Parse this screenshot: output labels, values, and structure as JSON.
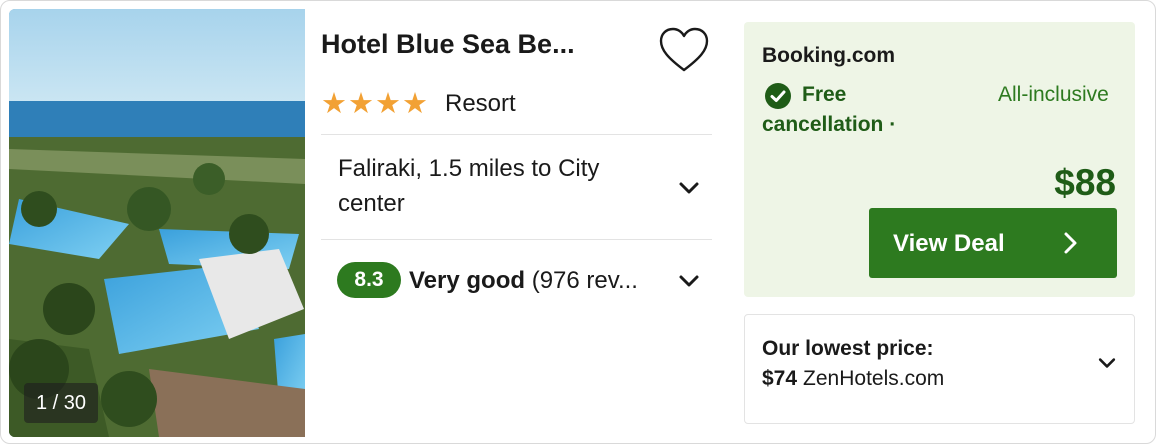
{
  "hotel": {
    "name": "Hotel Blue Sea Be...",
    "stars": 4,
    "type": "Resort",
    "location": "Faliraki, 1.5 miles to City center",
    "rating": {
      "score": "8.3",
      "label": "Very good",
      "reviews": "(976 rev..."
    }
  },
  "photo": {
    "counter": "1 / 30"
  },
  "deal": {
    "provider": "Booking.com",
    "cancellation": "Free cancellation",
    "separator": "·",
    "meal": "All-inclusive",
    "price": "$88",
    "button_label": "View Deal"
  },
  "lowest": {
    "label": "Our lowest price:",
    "price": "$74",
    "provider": "ZenHotels.com"
  },
  "icons": {
    "favorite": "heart-outline-icon",
    "expand": "chevron-down-icon",
    "check": "check-circle-icon",
    "next": "chevron-right-icon"
  },
  "colors": {
    "accent_green": "#2d7a1f",
    "dark_green": "#1f5c17",
    "deal_bg": "#eef5e6",
    "star": "#f2a134"
  }
}
